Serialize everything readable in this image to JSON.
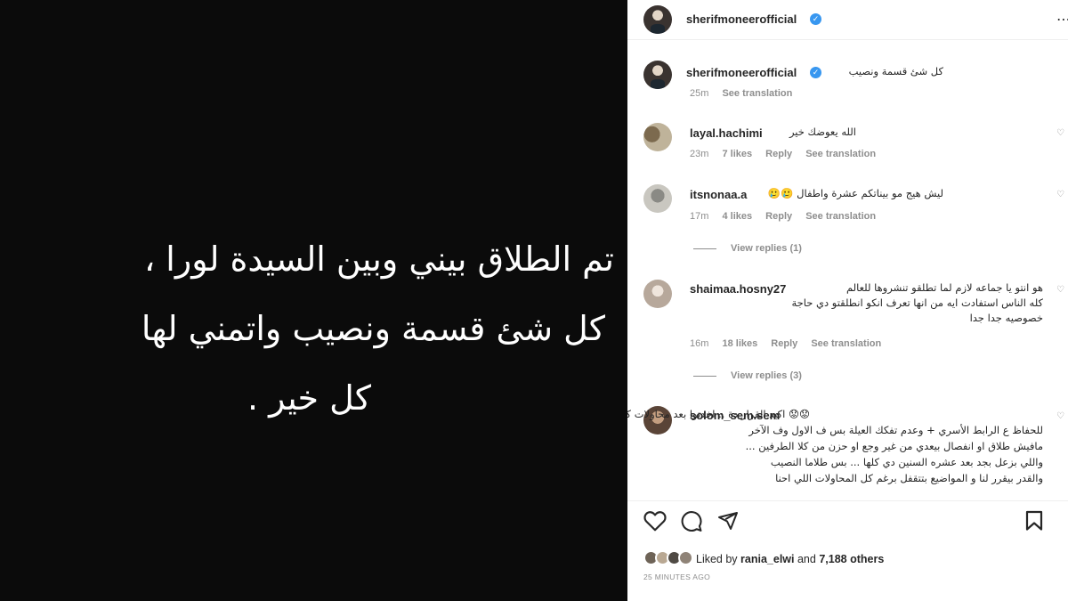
{
  "post_image": {
    "lines": [
      "تم الطلاق بيني وبين السيدة لورا ،",
      "كل شئ قسمة ونصيب  واتمني لها",
      "كل خير ."
    ]
  },
  "header": {
    "username": "sherifmoneerofficial",
    "more_icon": "more-horizontal-icon"
  },
  "caption": {
    "username": "sherifmoneerofficial",
    "text": "كل شئ قسمة ونصيب",
    "time": "25m",
    "see_translation": "See translation"
  },
  "comments": [
    {
      "username": "layal.hachimi",
      "lines": [
        "الله يعوضك خير"
      ],
      "time": "23m",
      "likes": "7 likes",
      "reply": "Reply",
      "see_translation": "See translation"
    },
    {
      "username": "itsnonaa.a",
      "lines": [
        "ليش هيج مو بيناتكم عشرة واطفال 🥲🥲"
      ],
      "time": "17m",
      "likes": "4 likes",
      "reply": "Reply",
      "see_translation": "See translation",
      "view_replies": "View replies (1)"
    },
    {
      "username": "shaimaa.hosny27",
      "lines": [
        "هو انتو يا جماعه لازم لما تطلقو تنشروها للعالم",
        "كله الناس استفادت ايه من انها تعرف انكو انطلقتو دي حاجة",
        "خصوصيه جدا جدا"
      ],
      "time": "16m",
      "likes": "18 likes",
      "reply": "Reply",
      "see_translation": "See translation",
      "view_replies": "View replies (3)"
    },
    {
      "username": "solom_sem.sem",
      "lines": [
        "😟😟 اكيد القرار دة .. اخدتوا بعد محاولات كتيرة",
        "للحفاظ ع الرابط الأسري + وعدم تفكك العيلة بس ف الاول وف الآخر",
        "مافيش طلاق او انفصال بيعدي من غير وجع او حزن من كلا الطرفين ...",
        "واللي بزعل بجد بعد عشره السنين دي كلها ... بس طلاما النصيب",
        "والقدر بيقرر لنا و المواضيع بتتقفل برغم كل المحاولات اللي احنا"
      ]
    }
  ],
  "actions": {
    "like_icon": "heart-icon",
    "comment_icon": "comment-icon",
    "share_icon": "share-icon",
    "save_icon": "bookmark-icon"
  },
  "likes": {
    "prefix": "Liked by",
    "user": "rania_elwi",
    "middle": "and",
    "others": "7,188 others"
  },
  "timestamp": "25 MINUTES AGO"
}
